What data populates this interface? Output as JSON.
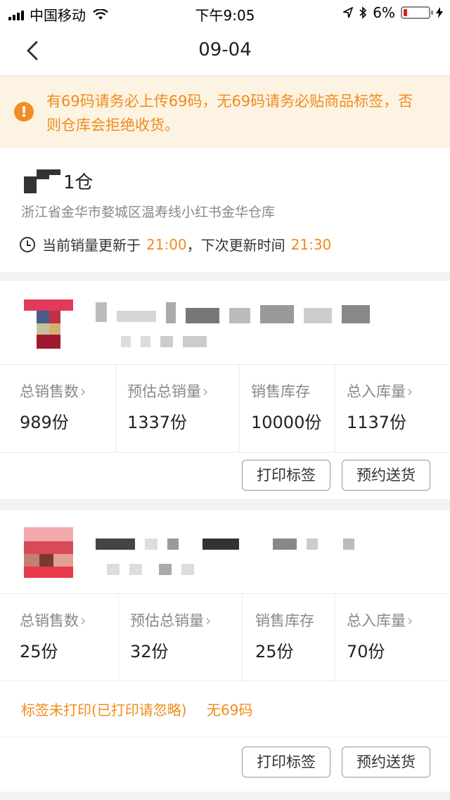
{
  "status_bar": {
    "carrier": "中国移动",
    "time": "下午9:05",
    "battery": "6%",
    "battery_level": 0.06
  },
  "nav": {
    "title": "09-04",
    "back_icon": "chevron-left-icon"
  },
  "notice": {
    "icon": "exclamation-circle-icon",
    "text": "有69码请务必上传69码，无69码请务必贴商品标签，否则仓库会拒绝收货。"
  },
  "warehouse": {
    "name_suffix": "1仓",
    "address": "浙江省金华市婺城区温寿线小红书金华仓库",
    "update_prefix": "当前销量更新于",
    "update_time": "21:00",
    "next_prefix": "，下次更新时间",
    "next_time": "21:30"
  },
  "products": [
    {
      "stats": [
        {
          "label": "总销售数",
          "value": "989份",
          "has_arrow": true
        },
        {
          "label": "预估总销量",
          "value": "1337份",
          "has_arrow": true
        },
        {
          "label": "销售库存",
          "value": "10000份",
          "has_arrow": false
        },
        {
          "label": "总入库量",
          "value": "1137份",
          "has_arrow": true
        }
      ],
      "actions": {
        "print": "打印标签",
        "deliver": "预约送货"
      }
    },
    {
      "stats": [
        {
          "label": "总销售数",
          "value": "25份",
          "has_arrow": true
        },
        {
          "label": "预估总销量",
          "value": "32份",
          "has_arrow": true
        },
        {
          "label": "销售库存",
          "value": "25份",
          "has_arrow": false
        },
        {
          "label": "总入库量",
          "value": "70份",
          "has_arrow": true
        }
      ],
      "warning": "标签未打印(已打印请忽略)",
      "no69": "无69码",
      "actions": {
        "print": "打印标签",
        "deliver": "预约送货"
      }
    }
  ],
  "colors": {
    "accent": "#f08c1a",
    "notice_bg": "#fdf3e3",
    "page_bg": "#f2f2f2"
  }
}
